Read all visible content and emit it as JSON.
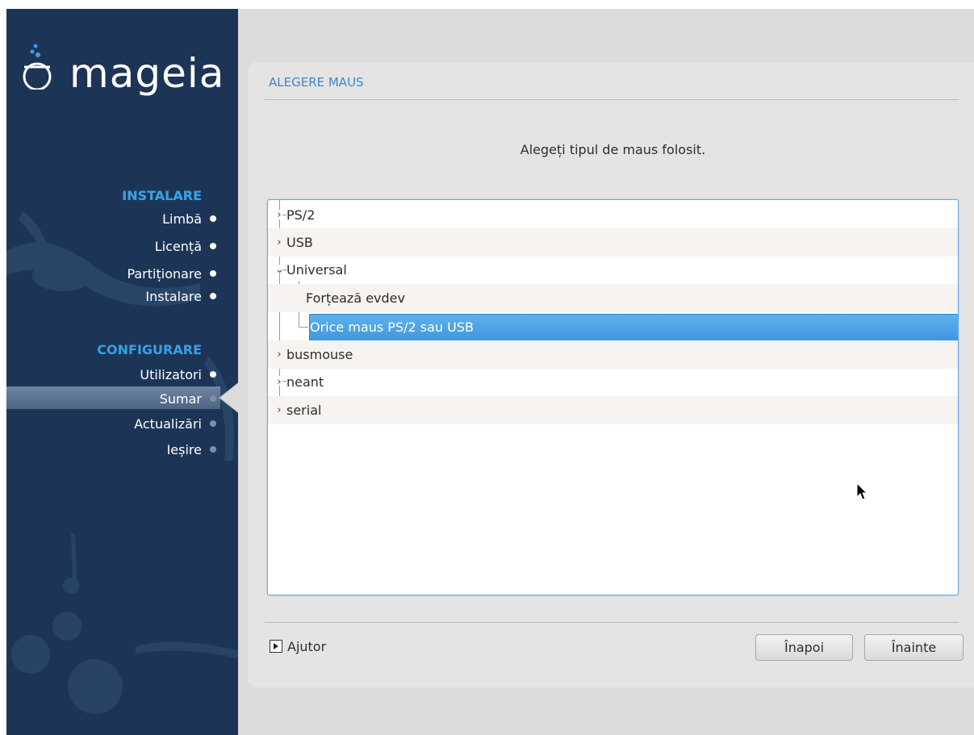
{
  "sidebar": {
    "logo_text": "mageia",
    "sections": [
      {
        "title": "INSTALARE",
        "steps": [
          {
            "label": "Limbă",
            "state": "done"
          },
          {
            "label": "Licență",
            "state": "done"
          },
          {
            "label": "Partiționare",
            "state": "done"
          },
          {
            "label": "Instalare",
            "state": "done"
          }
        ]
      },
      {
        "title": "CONFIGURARE",
        "steps": [
          {
            "label": "Utilizatori",
            "state": "done"
          },
          {
            "label": "Sumar",
            "state": "current"
          },
          {
            "label": "Actualizări",
            "state": "pending"
          },
          {
            "label": "Ieșire",
            "state": "pending"
          }
        ]
      }
    ]
  },
  "main": {
    "title": "ALEGERE MAUS",
    "subtitle": "Alegeți tipul de maus folosit.",
    "tree": [
      {
        "label": "PS/2",
        "level": 0,
        "expander": "›",
        "expanded": false
      },
      {
        "label": "USB",
        "level": 0,
        "expander": "›",
        "expanded": false
      },
      {
        "label": "Universal",
        "level": 0,
        "expander": "⌄",
        "expanded": true
      },
      {
        "label": "Forțează evdev",
        "level": 1
      },
      {
        "label": "Orice maus PS/2 sau USB",
        "level": 1,
        "selected": true
      },
      {
        "label": "busmouse",
        "level": 0,
        "expander": "›",
        "expanded": false
      },
      {
        "label": "neant",
        "level": 0,
        "expander": "›",
        "expanded": false
      },
      {
        "label": "serial",
        "level": 0,
        "expander": "›",
        "expanded": false
      }
    ],
    "help_label": "Ajutor",
    "back_label": "Înapoi",
    "next_label": "Înainte"
  },
  "colors": {
    "sidebar_bg": "#1c3557",
    "section_title": "#3b9fe3",
    "title_blue": "#3b84d8",
    "selection": "#4aa3e6"
  }
}
